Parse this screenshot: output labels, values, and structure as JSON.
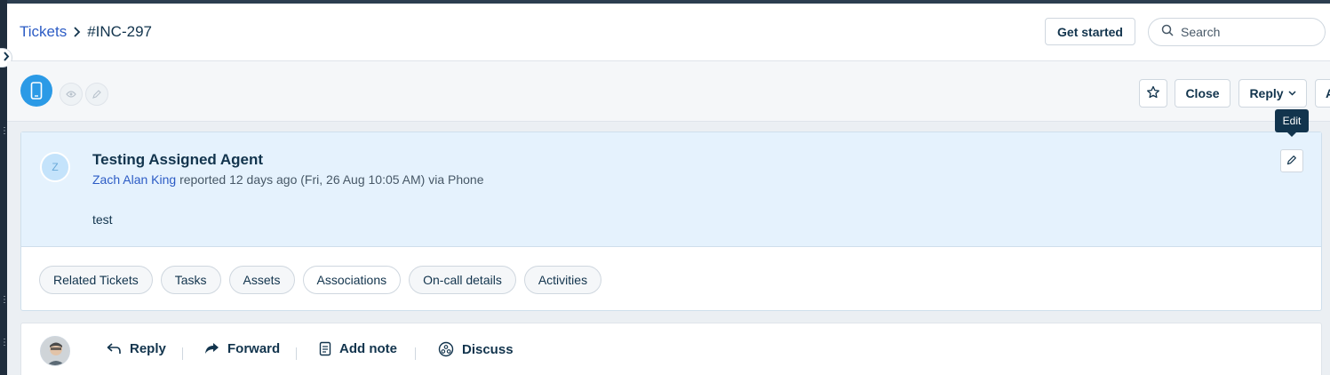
{
  "breadcrumb": {
    "parent": "Tickets",
    "current": "#INC-297"
  },
  "header": {
    "get_started": "Get started",
    "search_placeholder": "Search"
  },
  "toolbar": {
    "close_label": "Close",
    "reply_label": "Reply",
    "more_label_partial": "A"
  },
  "tooltip": {
    "text": "Edit"
  },
  "ticket": {
    "avatar_initial": "Z",
    "subject": "Testing Assigned Agent",
    "requester": "Zach Alan King",
    "meta": "reported 12 days ago (Fri, 26 Aug 10:05 AM) via Phone",
    "description": "test"
  },
  "tabs": [
    {
      "label": "Related Tickets"
    },
    {
      "label": "Tasks"
    },
    {
      "label": "Assets"
    },
    {
      "label": "Associations"
    },
    {
      "label": "On-call details"
    },
    {
      "label": "Activities"
    }
  ],
  "actions": {
    "reply": "Reply",
    "forward": "Forward",
    "add_note": "Add note",
    "discuss": "Discuss"
  },
  "colors": {
    "accent": "#2c5cc5",
    "source_icon": "#2b9ae6",
    "ticket_head_bg": "#e5f2fd"
  }
}
